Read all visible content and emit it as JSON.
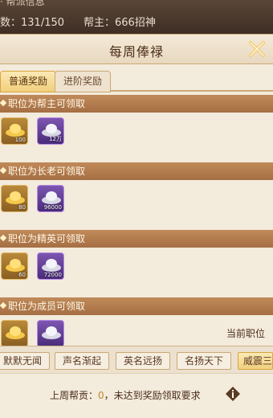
{
  "top": {
    "cut_title": "· 帮派信息",
    "member_count": "数：131/150",
    "leader": "帮主：666招神"
  },
  "panel": {
    "title": "每周俸禄",
    "close_icon": "close-x-icon"
  },
  "tabs": [
    {
      "label": "普通奖励",
      "active": true
    },
    {
      "label": "进阶奖励",
      "active": false
    }
  ],
  "sections": [
    {
      "header": "职位为帮主可领取",
      "items": [
        {
          "icon": "gold-ingot-icon",
          "qty": "100"
        },
        {
          "icon": "silver-ingot-icon",
          "qty": "12万"
        }
      ]
    },
    {
      "header": "职位为长老可领取",
      "items": [
        {
          "icon": "gold-ingot-icon",
          "qty": "80"
        },
        {
          "icon": "silver-ingot-icon",
          "qty": "96000"
        }
      ]
    },
    {
      "header": "职位为精英可领取",
      "items": [
        {
          "icon": "gold-ingot-icon",
          "qty": "60"
        },
        {
          "icon": "silver-ingot-icon",
          "qty": "72000"
        }
      ]
    },
    {
      "header": "职位为成员可领取",
      "items": [
        {
          "icon": "gold-ingot-icon",
          "qty": ""
        },
        {
          "icon": "silver-ingot-icon",
          "qty": ""
        }
      ]
    }
  ],
  "current_rank_label": "当前职位",
  "rank_levels": [
    {
      "label": "默默无闻",
      "active": false
    },
    {
      "label": "声名渐起",
      "active": false
    },
    {
      "label": "英名远扬",
      "active": false
    },
    {
      "label": "名扬天下",
      "active": false
    },
    {
      "label": "威震三",
      "active": true
    }
  ],
  "footer": {
    "prefix": "上周帮贡：",
    "value": "0",
    "suffix": "，未达到奖励领取要求",
    "info_icon": "info-icon"
  },
  "colors": {
    "section_header": "#b07a4e",
    "active_tab": "#f1d07d",
    "panel_bg": "#f3ebdc"
  }
}
